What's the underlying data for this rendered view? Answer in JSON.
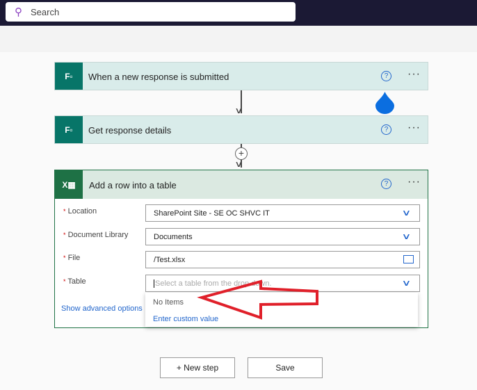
{
  "search": {
    "placeholder": "Search"
  },
  "steps": [
    {
      "title": "When a new response is submitted",
      "icon": "forms-icon"
    },
    {
      "title": "Get response details",
      "icon": "forms-icon"
    }
  ],
  "action": {
    "title": "Add a row into a table",
    "icon": "excel-icon",
    "fields": [
      {
        "label": "Location",
        "value": "SharePoint Site - SE OC SHVC IT",
        "required": "*"
      },
      {
        "label": "Document Library",
        "value": "Documents",
        "required": "*"
      },
      {
        "label": "File",
        "value": "/Test.xlsx",
        "required": "*"
      },
      {
        "label": "Table",
        "placeholder": "Select a table from the drop down.",
        "required": "*"
      }
    ],
    "dropdown": {
      "no_items": "No Items",
      "custom": "Enter custom value"
    },
    "advanced": "Show advanced options"
  },
  "buttons": {
    "new_step": "+ New step",
    "save": "Save"
  },
  "colors": {
    "forms": "#077568",
    "excel": "#1e7145",
    "link": "#2266cc",
    "annotation": "#e0202a"
  }
}
